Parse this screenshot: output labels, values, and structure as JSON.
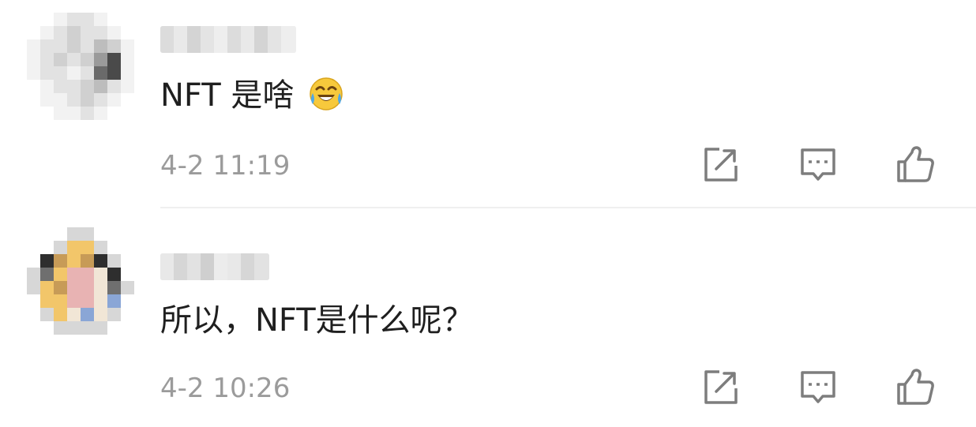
{
  "comments": [
    {
      "text": "NFT 是啥",
      "emoji": "laughing-crying-emoji",
      "timestamp": "4-2 11:19",
      "actions": [
        "share-icon",
        "reply-icon",
        "like-icon"
      ]
    },
    {
      "text": "所以，NFT是什么呢？",
      "timestamp": "4-2 10:26",
      "actions": [
        "share-icon",
        "reply-icon",
        "like-icon"
      ]
    }
  ],
  "colors": {
    "text": "#1f1f1f",
    "timestamp": "#9b9b9b",
    "icon": "#7d7d7d",
    "divider": "#efefef"
  }
}
